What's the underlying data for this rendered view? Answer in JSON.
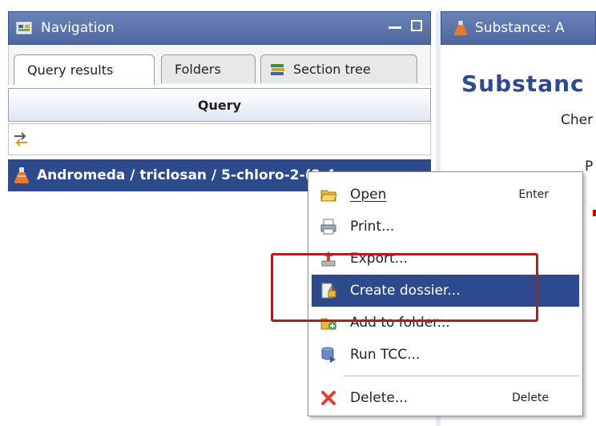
{
  "navigation": {
    "title": "Navigation",
    "tabs": [
      {
        "label": "Query results",
        "active": true
      },
      {
        "label": "Folders",
        "active": false
      },
      {
        "label": "Section tree",
        "active": false
      }
    ],
    "query_header": "Query",
    "result_item": "Andromeda / triclosan / 5-chloro-2-(2,4"
  },
  "editor": {
    "tab_title": "Substance: A",
    "heading": "Substanc",
    "subheading": "Cher",
    "partial_text": "P"
  },
  "context_menu": {
    "items": [
      {
        "label": "Open",
        "accelerator": "Enter",
        "icon": "folder-open-icon"
      },
      {
        "label": "Print...",
        "accelerator": "",
        "icon": "printer-icon"
      },
      {
        "label": "Export...",
        "accelerator": "",
        "icon": "export-icon"
      },
      {
        "label": "Create dossier...",
        "accelerator": "",
        "icon": "dossier-lock-icon",
        "selected": true
      },
      {
        "label": "Add to folder...",
        "accelerator": "",
        "icon": "add-folder-icon"
      },
      {
        "label": "Run TCC...",
        "accelerator": "",
        "icon": "database-icon"
      },
      {
        "label": "Delete...",
        "accelerator": "Delete",
        "icon": "delete-x-icon"
      }
    ]
  },
  "colors": {
    "header_blue": "#4e68a0",
    "selection_blue": "#2d4b8c",
    "highlight_red": "#b21d1d"
  }
}
